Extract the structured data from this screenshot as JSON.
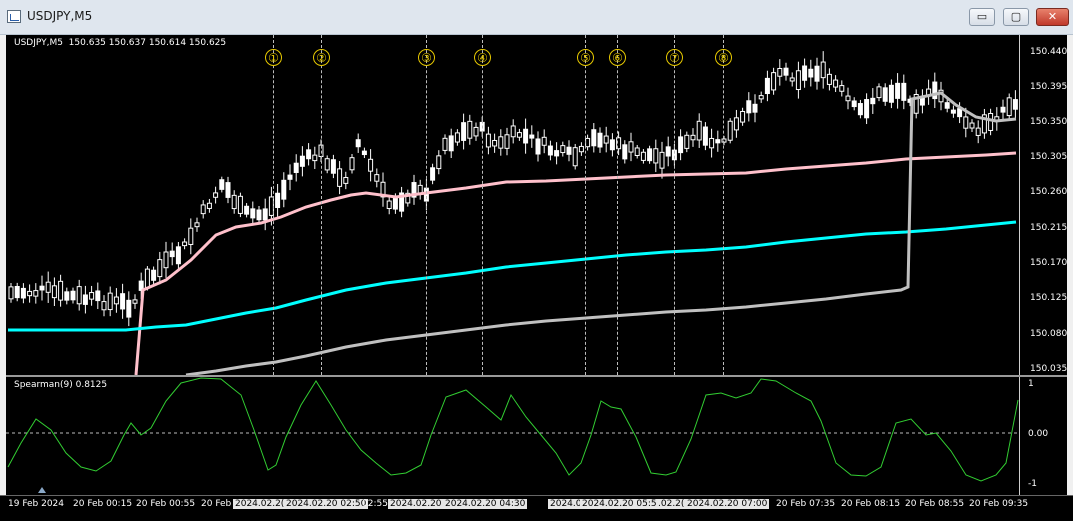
{
  "window": {
    "title": "USDJPY,M5",
    "min_label": "▭",
    "max_label": "▢",
    "close_label": "✕"
  },
  "chart": {
    "header": "USDJPY,M5  150.635 150.637 150.614 150.625",
    "price_ticks": [
      "150.440",
      "150.395",
      "150.350",
      "150.305",
      "150.260",
      "150.215",
      "150.170",
      "150.125",
      "150.080",
      "150.035"
    ],
    "markers": [
      "①",
      "②",
      "③",
      "④",
      "⑤",
      "⑥",
      "⑦",
      "⑧"
    ],
    "colors": {
      "bg": "#000000",
      "candle": "#ffffff",
      "ma_fast": "#ffc0cb",
      "ma_mid": "#00ffff",
      "ma_slow": "#c0c0c0",
      "osc": "#32cd32",
      "marker": "#e6c800"
    }
  },
  "oscillator": {
    "label": "Spearman(9) 0.8125",
    "ticks": [
      "1",
      "0.00",
      "-1"
    ]
  },
  "time_axis": [
    {
      "text": "19 Feb 2024",
      "hl": false
    },
    {
      "text": "20 Feb 00:15",
      "hl": false
    },
    {
      "text": "20 Feb 00:55",
      "hl": false
    },
    {
      "text": "20 Feb",
      "hl": false
    },
    {
      "text": "2024.02.2(",
      "hl": true
    },
    {
      "text": "2024.02.20 02:50",
      "hl": true
    },
    {
      "text": "02:55",
      "hl": false
    },
    {
      "text": "2024.02.20",
      "hl": true
    },
    {
      "text": "2024.02.20 04:30",
      "hl": true
    },
    {
      "text": "2024.0",
      "hl": true
    },
    {
      "text": "2024.02.20 05:55",
      "hl": true
    },
    {
      "text": ".02.2(",
      "hl": true
    },
    {
      "text": "2024.02.20 07:00",
      "hl": true
    },
    {
      "text": "20 Feb 07:35",
      "hl": false
    },
    {
      "text": "20 Feb 08:15",
      "hl": false
    },
    {
      "text": "20 Feb 08:55",
      "hl": false
    },
    {
      "text": "20 Feb 09:35",
      "hl": false
    }
  ]
}
